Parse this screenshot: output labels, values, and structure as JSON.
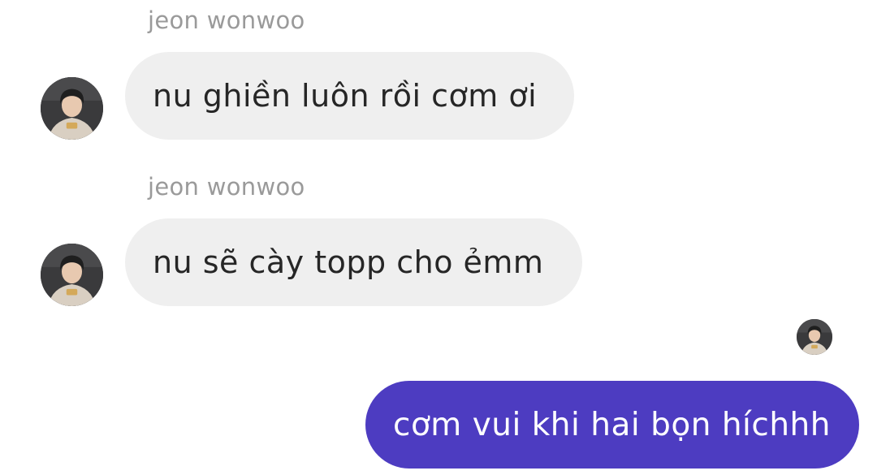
{
  "chat": {
    "messages": [
      {
        "sender": "jeon wonwoo",
        "text": "nu ghiền luôn rồi cơm ơi",
        "direction": "incoming"
      },
      {
        "sender": "jeon wonwoo",
        "text": "nu sẽ cày topp cho ẻmm",
        "direction": "incoming"
      },
      {
        "text": "cơm vui khi hai bọn híchhh",
        "direction": "outgoing"
      }
    ],
    "seen_avatar_icon": "user-avatar-icon"
  },
  "colors": {
    "incoming_bubble": "#efefef",
    "incoming_text": "#262626",
    "outgoing_bubble": "#4d3cc1",
    "outgoing_text": "#ffffff",
    "sender_name": "#9a9a9a"
  }
}
